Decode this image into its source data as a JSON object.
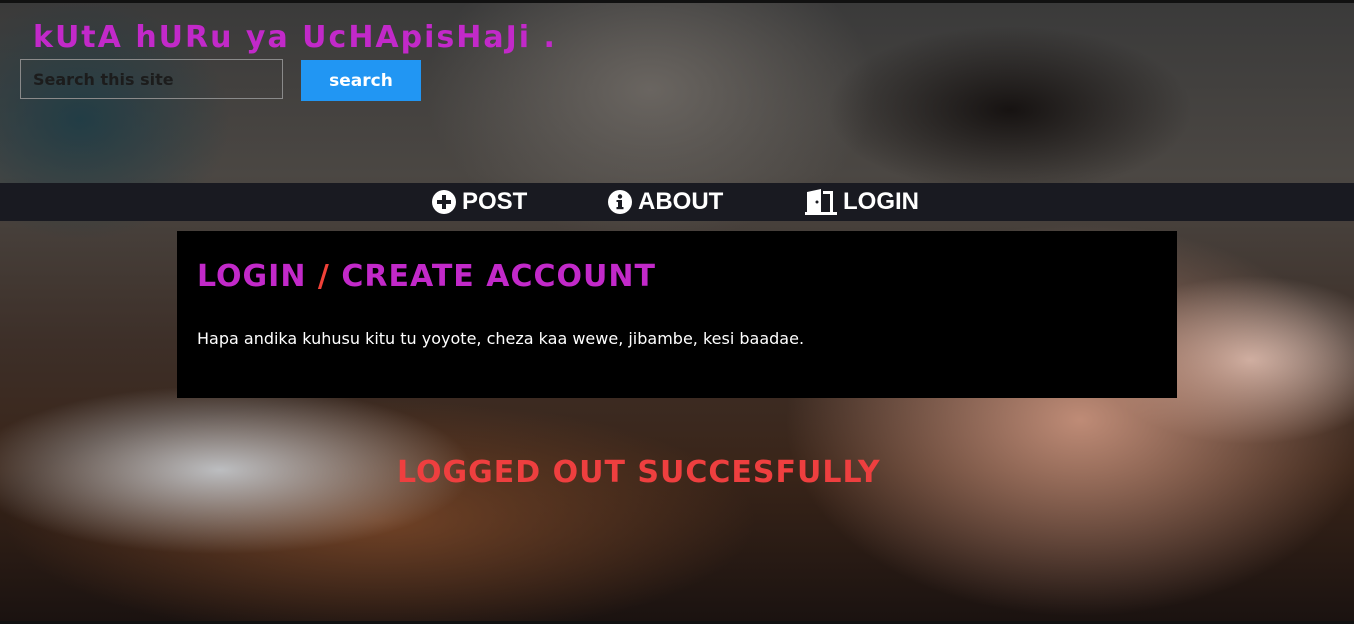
{
  "header": {
    "site_title": "kUtA hURu ya UcHApisHaJi .",
    "search_placeholder": "Search this site",
    "search_button_label": "search"
  },
  "nav": {
    "items": [
      {
        "label": "POST",
        "icon": "plus-circle-icon"
      },
      {
        "label": "ABOUT",
        "icon": "info-circle-icon"
      },
      {
        "label": "LOGIN",
        "icon": "door-open-icon"
      }
    ]
  },
  "panel": {
    "title_part1": "LOGIN",
    "title_separator": "/",
    "title_part2": "CREATE ACCOUNT",
    "text": "Hapa andika kuhusu kitu tu yoyote, cheza kaa wewe, jibambe, kesi baadae."
  },
  "status": {
    "message": "LOGGED OUT SUCCESFULLY"
  },
  "colors": {
    "title_magenta": "#c229c9",
    "accent_red": "#f04138",
    "button_blue": "#2196f3",
    "navbar_bg": "#191a21",
    "panel_bg": "#000000"
  }
}
